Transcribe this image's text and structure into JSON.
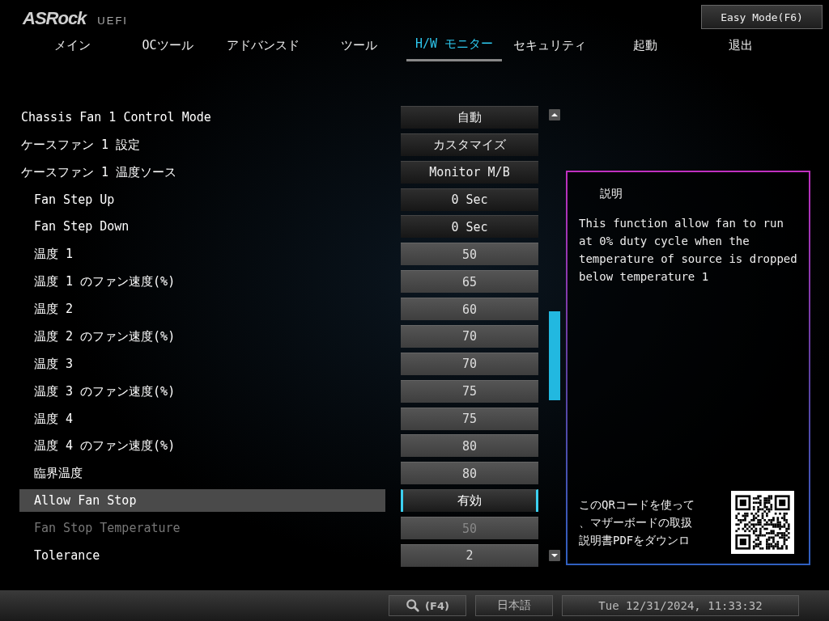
{
  "header": {
    "logo": "ASRock",
    "logo_suffix": "UEFI",
    "easy_mode_button": "Easy Mode(F6)"
  },
  "tabs": [
    {
      "label": "メイン",
      "selected": false
    },
    {
      "label": "OCツール",
      "selected": false
    },
    {
      "label": "アドバンスド",
      "selected": false
    },
    {
      "label": "ツール",
      "selected": false
    },
    {
      "label": "H/W モニター",
      "selected": true
    },
    {
      "label": "セキュリティ",
      "selected": false
    },
    {
      "label": "起動",
      "selected": false
    },
    {
      "label": "退出",
      "selected": false
    }
  ],
  "settings": [
    {
      "label": "Chassis Fan 1 Control Mode",
      "value": "自動",
      "kind": "option",
      "selected": false,
      "disabled": false
    },
    {
      "label": "ケースファン 1 設定",
      "value": "カスタマイズ",
      "kind": "option",
      "selected": false,
      "disabled": false
    },
    {
      "label": "ケースファン 1 温度ソース",
      "value": "Monitor M/B",
      "kind": "option",
      "selected": false,
      "disabled": false,
      "children": [
        {
          "label": "Fan Step Up",
          "value": "0 Sec",
          "kind": "option",
          "selected": false,
          "disabled": false
        },
        {
          "label": "Fan Step Down",
          "value": "0 Sec",
          "kind": "option",
          "selected": false,
          "disabled": false
        },
        {
          "label": "温度 1",
          "value": "50",
          "kind": "number",
          "selected": false,
          "disabled": false
        },
        {
          "label": "温度 1 のファン速度(%)",
          "value": "65",
          "kind": "number",
          "selected": false,
          "disabled": false
        },
        {
          "label": "温度 2",
          "value": "60",
          "kind": "number",
          "selected": false,
          "disabled": false
        },
        {
          "label": "温度 2 のファン速度(%)",
          "value": "70",
          "kind": "number",
          "selected": false,
          "disabled": false
        },
        {
          "label": "温度 3",
          "value": "70",
          "kind": "number",
          "selected": false,
          "disabled": false
        },
        {
          "label": "温度 3 のファン速度(%)",
          "value": "75",
          "kind": "number",
          "selected": false,
          "disabled": false
        },
        {
          "label": "温度 4",
          "value": "75",
          "kind": "number",
          "selected": false,
          "disabled": false
        },
        {
          "label": "温度 4 のファン速度(%)",
          "value": "80",
          "kind": "number",
          "selected": false,
          "disabled": false
        },
        {
          "label": "臨界温度",
          "value": "80",
          "kind": "number",
          "selected": false,
          "disabled": false
        },
        {
          "label": "Allow Fan Stop",
          "value": "有効",
          "kind": "option",
          "selected": true,
          "disabled": false
        },
        {
          "label": "Fan Stop Temperature",
          "value": "50",
          "kind": "number",
          "selected": false,
          "disabled": true
        },
        {
          "label": "Tolerance",
          "value": "2",
          "kind": "number",
          "selected": false,
          "disabled": false
        }
      ]
    }
  ],
  "description": {
    "title": "説明",
    "text": "This function allow fan to run at 0% duty cycle when the temperature of source is dropped below temperature 1",
    "qr_caption_lines": [
      "このQRコードを使って",
      "、マザーボードの取扱",
      "説明書PDFをダウンロ"
    ]
  },
  "status_bar": {
    "search_key": "(F4)",
    "language": "日本語",
    "datetime": "Tue 12/31/2024, 11:33:32"
  }
}
